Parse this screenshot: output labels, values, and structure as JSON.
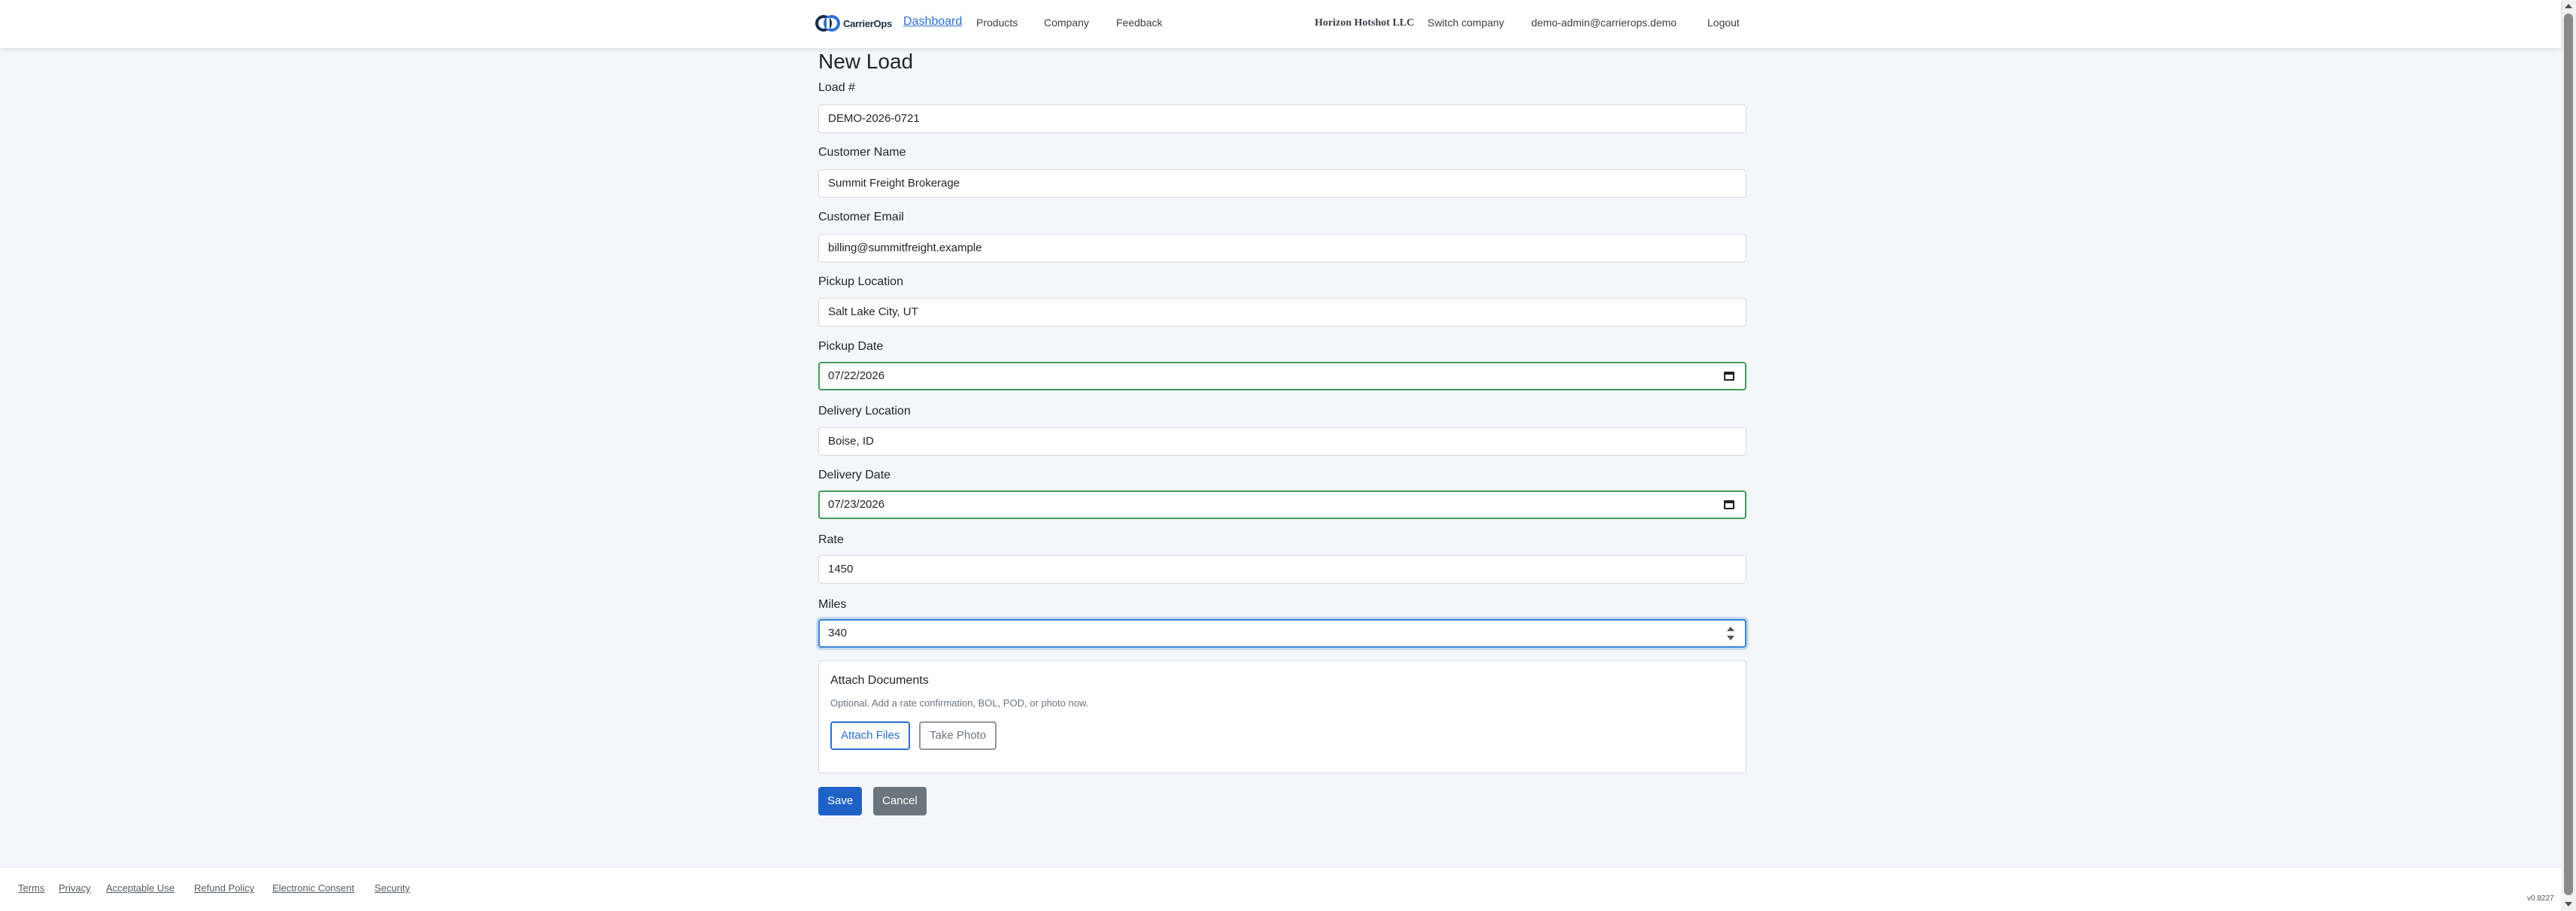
{
  "nav": {
    "brand": "CarrierOps",
    "links": [
      "Dashboard",
      "Products",
      "Company",
      "Feedback"
    ],
    "company": "Horizon Hotshot LLC",
    "switch_company": "Switch company",
    "user_email": "demo-admin@carrierops.demo",
    "logout": "Logout",
    "accent_color": "#2c6fd6"
  },
  "form": {
    "title": "New Load",
    "fields": [
      {
        "label": "Load #",
        "value": "DEMO-2026-0721"
      },
      {
        "label": "Customer Name",
        "value": "Summit Freight Brokerage"
      },
      {
        "label": "Customer Email",
        "value": "billing@summitfreight.example"
      },
      {
        "label": "Pickup Location",
        "value": "Salt Lake City, UT"
      },
      {
        "label": "Pickup Date",
        "value": "07/22/2026"
      },
      {
        "label": "Delivery Location",
        "value": "Boise, ID"
      },
      {
        "label": "Delivery Date",
        "value": "07/23/2026"
      },
      {
        "label": "Rate",
        "value": "1450"
      },
      {
        "label": "Miles",
        "value": "340"
      }
    ],
    "attach": {
      "title": "Attach Documents",
      "hint": "Optional. Add a rate confirmation, BOL, POD, or photo now.",
      "attach_files": "Attach Files",
      "take_photo": "Take Photo"
    },
    "save": "Save",
    "cancel": "Cancel",
    "valid_color": "#3f9d5b",
    "focus_color": "#3b82d6"
  },
  "footer": {
    "links": [
      "Terms",
      "Privacy",
      "Acceptable Use",
      "Refund Policy",
      "Electronic Consent",
      "Security"
    ],
    "version": "v0.8227"
  }
}
